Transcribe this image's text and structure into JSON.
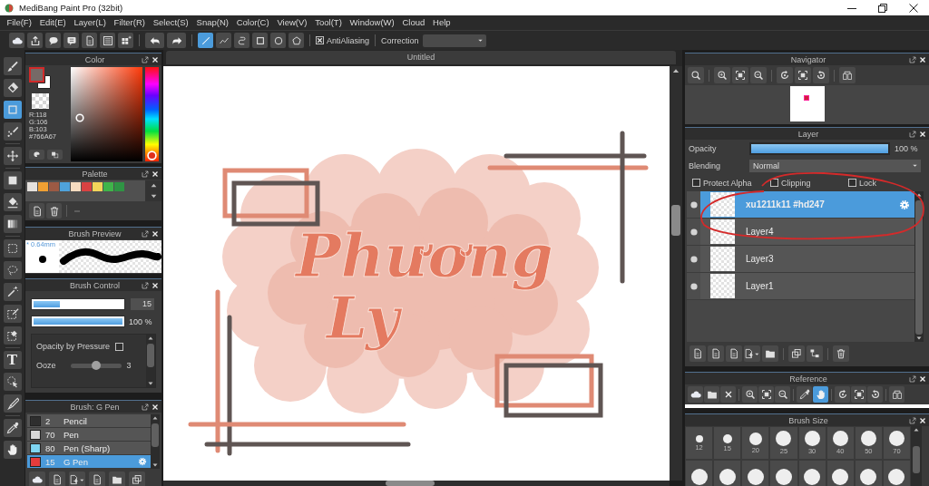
{
  "window": {
    "title": "MediBang Paint Pro (32bit)"
  },
  "menu": [
    "File(F)",
    "Edit(E)",
    "Layer(L)",
    "Filter(R)",
    "Select(S)",
    "Snap(N)",
    "Color(C)",
    "View(V)",
    "Tool(T)",
    "Window(W)",
    "Cloud",
    "Help"
  ],
  "toolbar": {
    "groups": [
      [
        {
          "kind": "cloud"
        },
        {
          "kind": "share"
        },
        {
          "kind": "speech"
        },
        {
          "kind": "comment"
        },
        {
          "kind": "document"
        },
        {
          "kind": "list"
        },
        {
          "kind": "grid"
        }
      ],
      [
        {
          "kind": "undo"
        },
        {
          "kind": "redo"
        }
      ],
      [
        {
          "kind": "line",
          "selected": true
        },
        {
          "kind": "polyline",
          "selected": false
        },
        {
          "kind": "curve",
          "selected": false
        },
        {
          "kind": "rect",
          "selected": false
        },
        {
          "kind": "ellipse",
          "selected": false
        },
        {
          "kind": "polygon",
          "selected": false
        }
      ]
    ],
    "antialiasing": {
      "label": "AntiAliasing",
      "checked": true
    },
    "correction": {
      "label": "Correction"
    }
  },
  "tools": [
    [
      {
        "kind": "brush",
        "selected": false
      },
      {
        "kind": "eraser",
        "selected": false
      },
      {
        "kind": "rect",
        "selected": true
      },
      {
        "kind": "dotbrush",
        "selected": false
      }
    ],
    [
      {
        "kind": "move",
        "selected": false
      }
    ],
    [
      {
        "kind": "fill",
        "selected": false
      },
      {
        "kind": "bucket",
        "selected": false
      },
      {
        "kind": "gradient",
        "selected": false
      }
    ],
    [
      {
        "kind": "select",
        "selected": false
      },
      {
        "kind": "lasso",
        "selected": false
      },
      {
        "kind": "wand",
        "selected": false
      },
      {
        "kind": "selpen",
        "selected": false
      },
      {
        "kind": "seleraser",
        "selected": false
      }
    ],
    [
      {
        "kind": "text",
        "glyph": "T",
        "selected": false
      },
      {
        "kind": "pointer",
        "selected": false
      },
      {
        "kind": "knife",
        "selected": false
      }
    ],
    [
      {
        "kind": "eyedropper",
        "selected": false
      },
      {
        "kind": "hand",
        "selected": false
      }
    ]
  ],
  "color_panel": {
    "title": "Color",
    "swatches": [
      {
        "color": "#766a67",
        "selected": true
      },
      {
        "color": "#ffffff",
        "selected": false
      }
    ],
    "readout": [
      "R:118",
      "G:106",
      "B:103",
      "#766A67"
    ],
    "buttons": [
      {
        "kind": "palette"
      },
      {
        "kind": "swap"
      }
    ]
  },
  "palette": {
    "title": "Palette",
    "swatches": [
      {
        "color": "#e6e2de"
      },
      {
        "color": "#f0a033"
      },
      {
        "color": "#9c5a44"
      },
      {
        "color": "#4fa3dc"
      },
      {
        "color": "#f7dcc0"
      },
      {
        "color": "#d94242"
      },
      {
        "color": "#f2d45a"
      },
      {
        "color": "#3fb44a"
      },
      {
        "color": "#2f9444"
      }
    ],
    "buttons": [
      {
        "kind": "document"
      },
      {
        "kind": "trash"
      }
    ]
  },
  "brush_preview": {
    "title": "Brush Preview",
    "size": "* 0.64mm"
  },
  "brush_control": {
    "title": "Brush Control",
    "size": {
      "level": 0.3,
      "reading": "15"
    },
    "opacity": {
      "level": 1,
      "reading": "100 %"
    },
    "options": [
      {
        "kind": "checkbox",
        "label": "Opacity by Pressure",
        "checked": false
      },
      {
        "kind": "slider",
        "label": "Ooze",
        "level": 0.5,
        "reading": "3"
      }
    ]
  },
  "brushes": {
    "title": "Brush: G Pen",
    "items": [
      {
        "color": "#2e2e2e",
        "size": "2",
        "name": "Pencil",
        "selected": false
      },
      {
        "color": "#d8d8d8",
        "size": "70",
        "name": "Pen",
        "selected": false
      },
      {
        "color": "#7fd6f2",
        "size": "80",
        "name": "Pen (Sharp)",
        "selected": false
      },
      {
        "color": "#e53b3b",
        "size": "15",
        "name": "G Pen",
        "selected": true
      }
    ],
    "buttons": [
      [
        {
          "kind": "cloud"
        },
        {
          "kind": "document"
        },
        {
          "kind": "add"
        },
        {
          "kind": "document"
        },
        {
          "kind": "folder"
        },
        {
          "kind": "copy"
        }
      ]
    ]
  },
  "canvas": {
    "tab": "Untitled",
    "lettering": [
      "Phương",
      "Ly"
    ]
  },
  "navigator": {
    "title": "Navigator",
    "tools": [
      [
        {
          "kind": "magnifier"
        }
      ],
      [
        {
          "kind": "zoomin"
        },
        {
          "kind": "fit"
        },
        {
          "kind": "zoomout"
        }
      ],
      [
        {
          "kind": "rotleft"
        },
        {
          "kind": "fit"
        },
        {
          "kind": "rotright"
        }
      ],
      [
        {
          "kind": "flip"
        }
      ]
    ]
  },
  "layers": {
    "title": "Layer",
    "opacity": {
      "label": "Opacity",
      "level": 1,
      "reading": "100 %"
    },
    "blending": {
      "label": "Blending",
      "value": "Normal"
    },
    "options": [
      {
        "label": "Protect Alpha",
        "checked": false
      },
      {
        "label": "Clipping",
        "checked": false
      },
      {
        "label": "Lock",
        "checked": false
      }
    ],
    "items": [
      {
        "name": "xu1211k11 #hd247",
        "selected": true
      },
      {
        "name": "Layer4",
        "selected": false
      },
      {
        "name": "Layer3",
        "selected": false
      },
      {
        "name": "Layer1",
        "selected": false
      }
    ],
    "tools": [
      [
        {
          "kind": "document"
        },
        {
          "kind": "document"
        },
        {
          "kind": "document"
        },
        {
          "kind": "add"
        },
        {
          "kind": "folder"
        }
      ],
      [
        {
          "kind": "copy"
        },
        {
          "kind": "merge"
        }
      ],
      [
        {
          "kind": "trash"
        }
      ]
    ]
  },
  "reference": {
    "title": "Reference",
    "tools": [
      [
        {
          "kind": "cloud",
          "selected": false
        },
        {
          "kind": "folder",
          "selected": false
        },
        {
          "kind": "close",
          "selected": false
        }
      ],
      [
        {
          "kind": "zoomin",
          "selected": false
        },
        {
          "kind": "fit",
          "selected": false
        },
        {
          "kind": "zoomout",
          "selected": false
        }
      ],
      [
        {
          "kind": "eyedropper",
          "selected": false
        },
        {
          "kind": "hand",
          "selected": true
        }
      ],
      [
        {
          "kind": "rotleft",
          "selected": false
        },
        {
          "kind": "fit",
          "selected": false
        },
        {
          "kind": "rotright",
          "selected": false
        }
      ],
      [
        {
          "kind": "flip",
          "selected": false
        }
      ]
    ]
  },
  "brush_size": {
    "title": "Brush Size",
    "sizes": [
      "12",
      "15",
      "20",
      "25",
      "30",
      "40",
      "50",
      "70"
    ]
  }
}
